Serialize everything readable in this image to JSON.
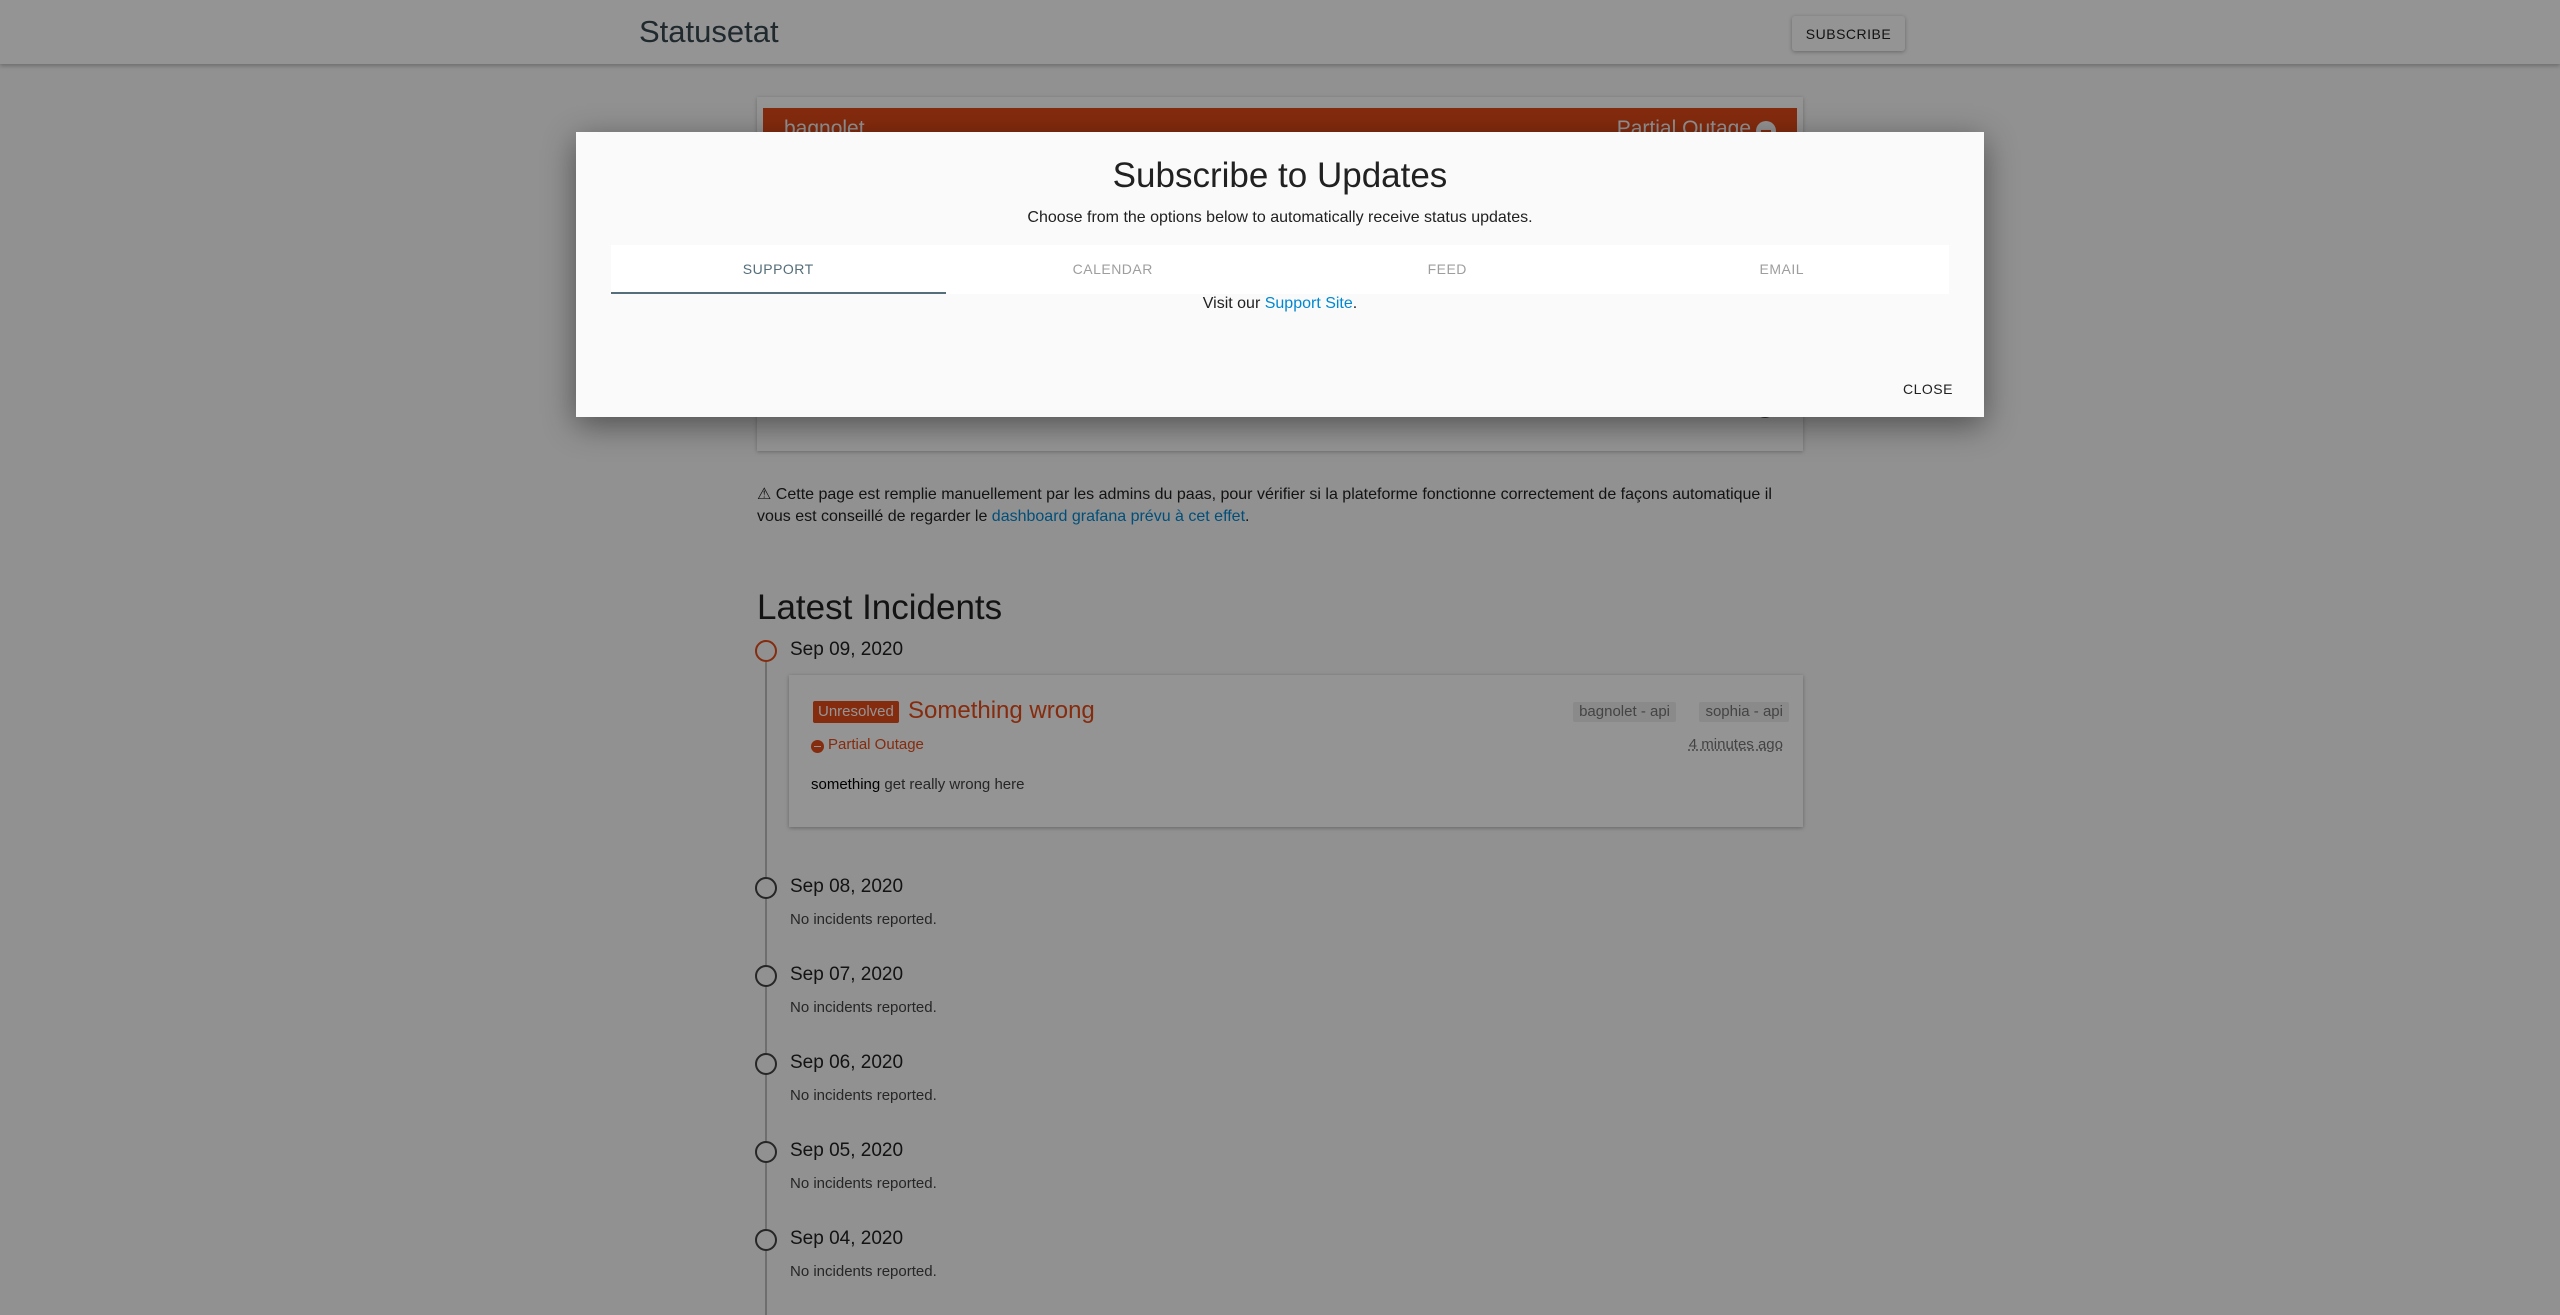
{
  "header": {
    "brand": "Statusetat",
    "subscribe_label": "SUBSCRIBE"
  },
  "component": {
    "name": "bagnolet",
    "status": "Partial Outage",
    "status_color": "#e64a19"
  },
  "notice": {
    "text_before": "⚠ Cette page est remplie manuellement par les admins du paas, pour vérifier si la plateforme fonctionne correctement de façons automatique il vous est conseillé de regarder le ",
    "link_text": "dashboard grafana prévu à cet effet",
    "text_after": "."
  },
  "incidents_section": {
    "title": "Latest Incidents",
    "days": [
      {
        "date": "Sep 09, 2020"
      },
      {
        "date": "Sep 08, 2020",
        "empty": "No incidents reported."
      },
      {
        "date": "Sep 07, 2020",
        "empty": "No incidents reported."
      },
      {
        "date": "Sep 06, 2020",
        "empty": "No incidents reported."
      },
      {
        "date": "Sep 05, 2020",
        "empty": "No incidents reported."
      },
      {
        "date": "Sep 04, 2020",
        "empty": "No incidents reported."
      }
    ],
    "incident": {
      "badge": "Unresolved",
      "title": "Something wrong",
      "tags": [
        "bagnolet - api",
        "sophia - api"
      ],
      "impact": "Partial Outage",
      "time": "4 minutes ago",
      "body_bold": "something",
      "body_rest": " get really wrong here"
    }
  },
  "modal": {
    "title": "Subscribe to Updates",
    "description": "Choose from the options below to automatically receive status updates.",
    "tabs": [
      {
        "label": "SUPPORT",
        "active": true
      },
      {
        "label": "CALENDAR"
      },
      {
        "label": "FEED"
      },
      {
        "label": "EMAIL"
      }
    ],
    "content_before": "Visit our ",
    "content_link": "Support Site",
    "content_after": ".",
    "close_label": "CLOSE"
  },
  "colors": {
    "accent": "#546e7a",
    "danger": "#e64a19",
    "link": "#0288d1"
  }
}
